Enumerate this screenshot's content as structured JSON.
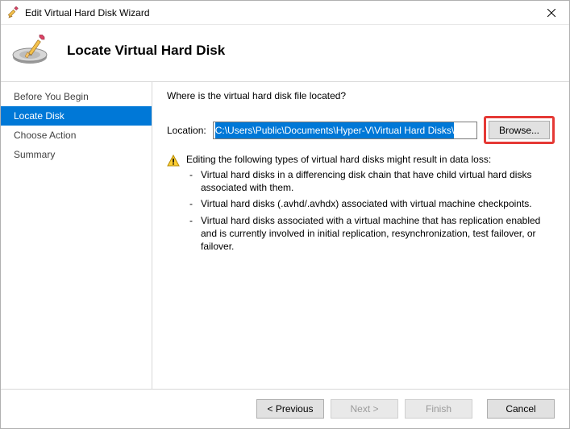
{
  "window": {
    "title": "Edit Virtual Hard Disk Wizard",
    "page_title": "Locate Virtual Hard Disk"
  },
  "sidebar": {
    "steps": [
      {
        "label": "Before You Begin",
        "active": false
      },
      {
        "label": "Locate Disk",
        "active": true
      },
      {
        "label": "Choose Action",
        "active": false
      },
      {
        "label": "Summary",
        "active": false
      }
    ]
  },
  "content": {
    "question": "Where is the virtual hard disk file located?",
    "location_label": "Location:",
    "location_value": "C:\\Users\\Public\\Documents\\Hyper-V\\Virtual Hard Disks\\",
    "browse_label": "Browse...",
    "warning_intro": "Editing the following types of virtual hard disks might result in data loss:",
    "warning_items": [
      "Virtual hard disks in a differencing disk chain that have child virtual hard disks associated with them.",
      "Virtual hard disks (.avhd/.avhdx) associated with virtual machine checkpoints.",
      "Virtual hard disks associated with a virtual machine that has replication enabled and is currently involved in initial replication, resynchronization, test failover, or failover."
    ]
  },
  "footer": {
    "previous": "< Previous",
    "next": "Next >",
    "finish": "Finish",
    "cancel": "Cancel",
    "next_enabled": false,
    "finish_enabled": false
  },
  "highlight": {
    "browse_button": true
  }
}
